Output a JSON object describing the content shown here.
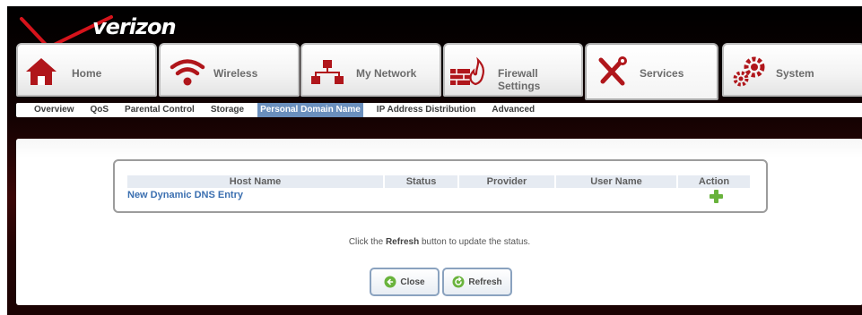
{
  "brand": {
    "logo_text": "verizon"
  },
  "tabs": [
    {
      "label": "Home",
      "icon": "home-icon"
    },
    {
      "label": "Wireless",
      "icon": "wireless-icon"
    },
    {
      "label": "My Network",
      "icon": "network-icon"
    },
    {
      "label": "Firewall Settings",
      "icon": "firewall-icon"
    },
    {
      "label": "Services",
      "icon": "tools-icon",
      "active": true
    },
    {
      "label": "System",
      "icon": "gears-icon"
    }
  ],
  "subnav": [
    {
      "label": "Overview"
    },
    {
      "label": "QoS"
    },
    {
      "label": "Parental Control"
    },
    {
      "label": "Storage"
    },
    {
      "label": "Personal Domain Name",
      "active": true
    },
    {
      "label": "IP Address Distribution"
    },
    {
      "label": "Advanced"
    }
  ],
  "table": {
    "columns": [
      "Host Name",
      "Status",
      "Provider",
      "User Name",
      "Action"
    ],
    "new_entry_label": "New Dynamic DNS Entry",
    "add_icon": "add-icon"
  },
  "hint": {
    "before": "Click the",
    "bold": "Refresh",
    "after": "button to update the status."
  },
  "buttons": {
    "close": "Close",
    "refresh": "Refresh"
  },
  "colors": {
    "accent": "#6a8fbd",
    "brand_red": "#d6131b",
    "link": "#3b6fb0",
    "icon_red": "#b0161b",
    "icon_green": "#69b33c"
  }
}
